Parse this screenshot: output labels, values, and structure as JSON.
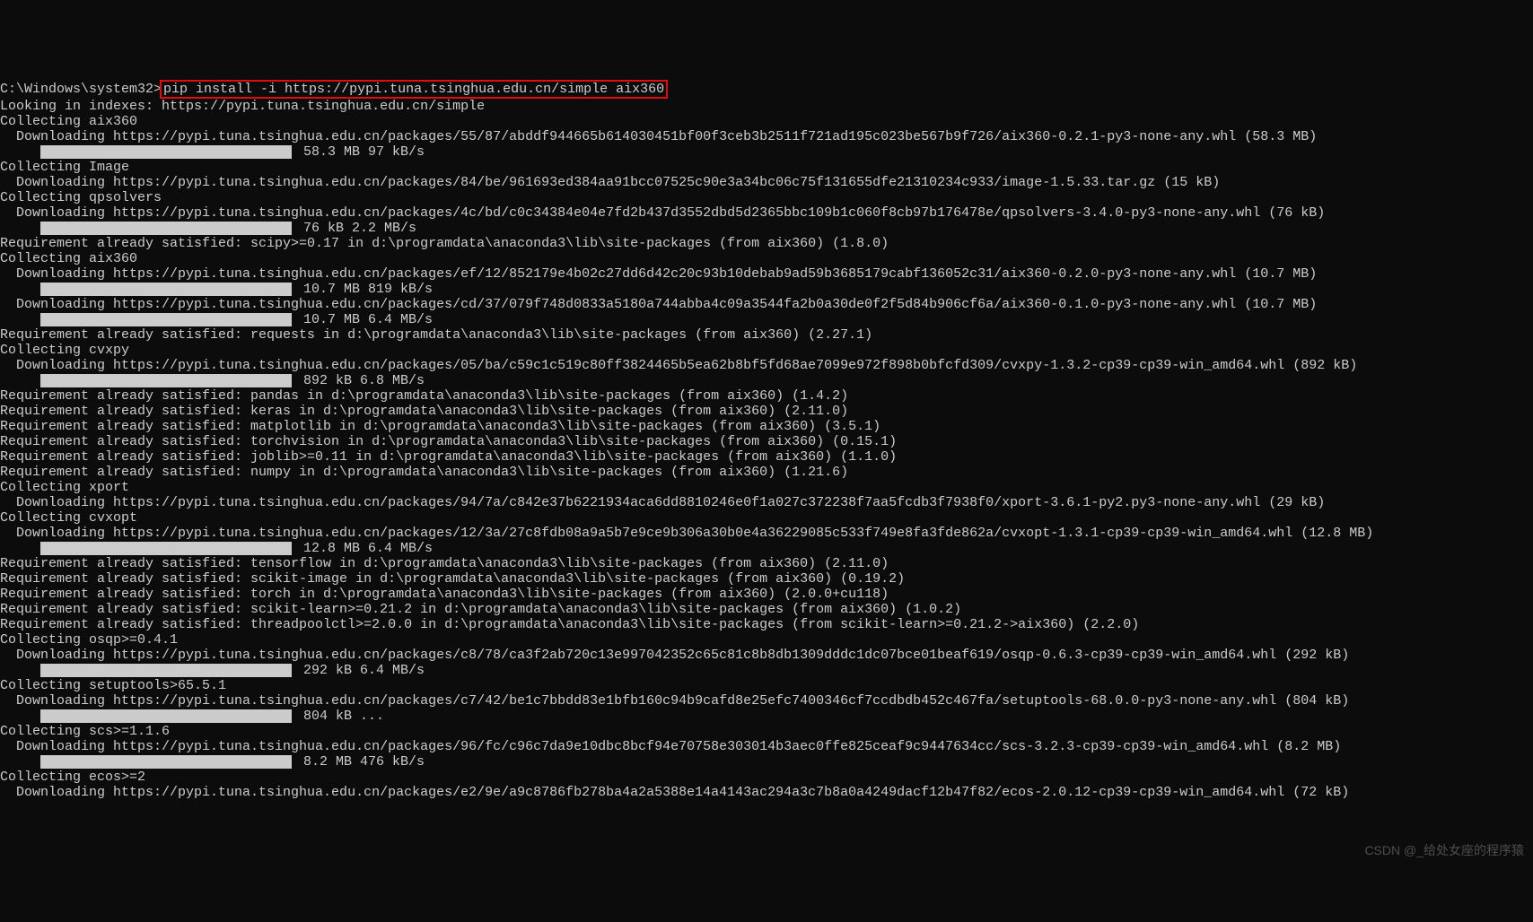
{
  "prompt_prefix": "C:\\Windows\\system32>",
  "command": "pip install -i https://pypi.tuna.tsinghua.edu.cn/simple aix360",
  "lines": [
    "Looking in indexes: https://pypi.tuna.tsinghua.edu.cn/simple",
    "Collecting aix360",
    "  Downloading https://pypi.tuna.tsinghua.edu.cn/packages/55/87/abddf944665b614030451bf00f3ceb3b2511f721ad195c023be567b9f726/aix360-0.2.1-py3-none-any.whl (58.3 MB)",
    {
      "type": "progress",
      "width": "pb-full",
      "text": "58.3 MB 97 kB/s"
    },
    "Collecting Image",
    "  Downloading https://pypi.tuna.tsinghua.edu.cn/packages/84/be/961693ed384aa91bcc07525c90e3a34bc06c75f131655dfe21310234c933/image-1.5.33.tar.gz (15 kB)",
    "Collecting qpsolvers",
    "  Downloading https://pypi.tuna.tsinghua.edu.cn/packages/4c/bd/c0c34384e04e7fd2b437d3552dbd5d2365bbc109b1c060f8cb97b176478e/qpsolvers-3.4.0-py3-none-any.whl (76 kB)",
    {
      "type": "progress",
      "width": "pb-full",
      "text": "76 kB 2.2 MB/s"
    },
    "Requirement already satisfied: scipy>=0.17 in d:\\programdata\\anaconda3\\lib\\site-packages (from aix360) (1.8.0)",
    "Collecting aix360",
    "  Downloading https://pypi.tuna.tsinghua.edu.cn/packages/ef/12/852179e4b02c27dd6d42c20c93b10debab9ad59b3685179cabf136052c31/aix360-0.2.0-py3-none-any.whl (10.7 MB)",
    {
      "type": "progress",
      "width": "pb-full",
      "text": "10.7 MB 819 kB/s"
    },
    "  Downloading https://pypi.tuna.tsinghua.edu.cn/packages/cd/37/079f748d0833a5180a744abba4c09a3544fa2b0a30de0f2f5d84b906cf6a/aix360-0.1.0-py3-none-any.whl (10.7 MB)",
    {
      "type": "progress",
      "width": "pb-full",
      "text": "10.7 MB 6.4 MB/s"
    },
    "Requirement already satisfied: requests in d:\\programdata\\anaconda3\\lib\\site-packages (from aix360) (2.27.1)",
    "Collecting cvxpy",
    "  Downloading https://pypi.tuna.tsinghua.edu.cn/packages/05/ba/c59c1c519c80ff3824465b5ea62b8bf5fd68ae7099e972f898b0bfcfd309/cvxpy-1.3.2-cp39-cp39-win_amd64.whl (892 kB)",
    {
      "type": "progress",
      "width": "pb-full",
      "text": "892 kB 6.8 MB/s"
    },
    "Requirement already satisfied: pandas in d:\\programdata\\anaconda3\\lib\\site-packages (from aix360) (1.4.2)",
    "Requirement already satisfied: keras in d:\\programdata\\anaconda3\\lib\\site-packages (from aix360) (2.11.0)",
    "Requirement already satisfied: matplotlib in d:\\programdata\\anaconda3\\lib\\site-packages (from aix360) (3.5.1)",
    "Requirement already satisfied: torchvision in d:\\programdata\\anaconda3\\lib\\site-packages (from aix360) (0.15.1)",
    "Requirement already satisfied: joblib>=0.11 in d:\\programdata\\anaconda3\\lib\\site-packages (from aix360) (1.1.0)",
    "Requirement already satisfied: numpy in d:\\programdata\\anaconda3\\lib\\site-packages (from aix360) (1.21.6)",
    "Collecting xport",
    "  Downloading https://pypi.tuna.tsinghua.edu.cn/packages/94/7a/c842e37b6221934aca6dd8810246e0f1a027c372238f7aa5fcdb3f7938f0/xport-3.6.1-py2.py3-none-any.whl (29 kB)",
    "Collecting cvxopt",
    "  Downloading https://pypi.tuna.tsinghua.edu.cn/packages/12/3a/27c8fdb08a9a5b7e9ce9b306a30b0e4a36229085c533f749e8fa3fde862a/cvxopt-1.3.1-cp39-cp39-win_amd64.whl (12.8 MB)",
    {
      "type": "progress",
      "width": "pb-full",
      "text": "12.8 MB 6.4 MB/s"
    },
    "Requirement already satisfied: tensorflow in d:\\programdata\\anaconda3\\lib\\site-packages (from aix360) (2.11.0)",
    "Requirement already satisfied: scikit-image in d:\\programdata\\anaconda3\\lib\\site-packages (from aix360) (0.19.2)",
    "Requirement already satisfied: torch in d:\\programdata\\anaconda3\\lib\\site-packages (from aix360) (2.0.0+cu118)",
    "Requirement already satisfied: scikit-learn>=0.21.2 in d:\\programdata\\anaconda3\\lib\\site-packages (from aix360) (1.0.2)",
    "Requirement already satisfied: threadpoolctl>=2.0.0 in d:\\programdata\\anaconda3\\lib\\site-packages (from scikit-learn>=0.21.2->aix360) (2.2.0)",
    "Collecting osqp>=0.4.1",
    "  Downloading https://pypi.tuna.tsinghua.edu.cn/packages/c8/78/ca3f2ab720c13e997042352c65c81c8b8db1309dddc1dc07bce01beaf619/osqp-0.6.3-cp39-cp39-win_amd64.whl (292 kB)",
    {
      "type": "progress",
      "width": "pb-full",
      "text": "292 kB 6.4 MB/s"
    },
    "Collecting setuptools>65.5.1",
    "  Downloading https://pypi.tuna.tsinghua.edu.cn/packages/c7/42/be1c7bbdd83e1bfb160c94b9cafd8e25efc7400346cf7ccdbdb452c467fa/setuptools-68.0.0-py3-none-any.whl (804 kB)",
    {
      "type": "progress",
      "width": "pb-full",
      "text": "804 kB ..."
    },
    "Collecting scs>=1.1.6",
    "  Downloading https://pypi.tuna.tsinghua.edu.cn/packages/96/fc/c96c7da9e10dbc8bcf94e70758e303014b3aec0ffe825ceaf9c9447634cc/scs-3.2.3-cp39-cp39-win_amd64.whl (8.2 MB)",
    {
      "type": "progress",
      "width": "pb-full",
      "text": "8.2 MB 476 kB/s"
    },
    "Collecting ecos>=2",
    "  Downloading https://pypi.tuna.tsinghua.edu.cn/packages/e2/9e/a9c8786fb278ba4a2a5388e14a4143ac294a3c7b8a0a4249dacf12b47f82/ecos-2.0.12-cp39-cp39-win_amd64.whl (72 kB)"
  ],
  "watermark": "CSDN @_给处女座的程序猿"
}
